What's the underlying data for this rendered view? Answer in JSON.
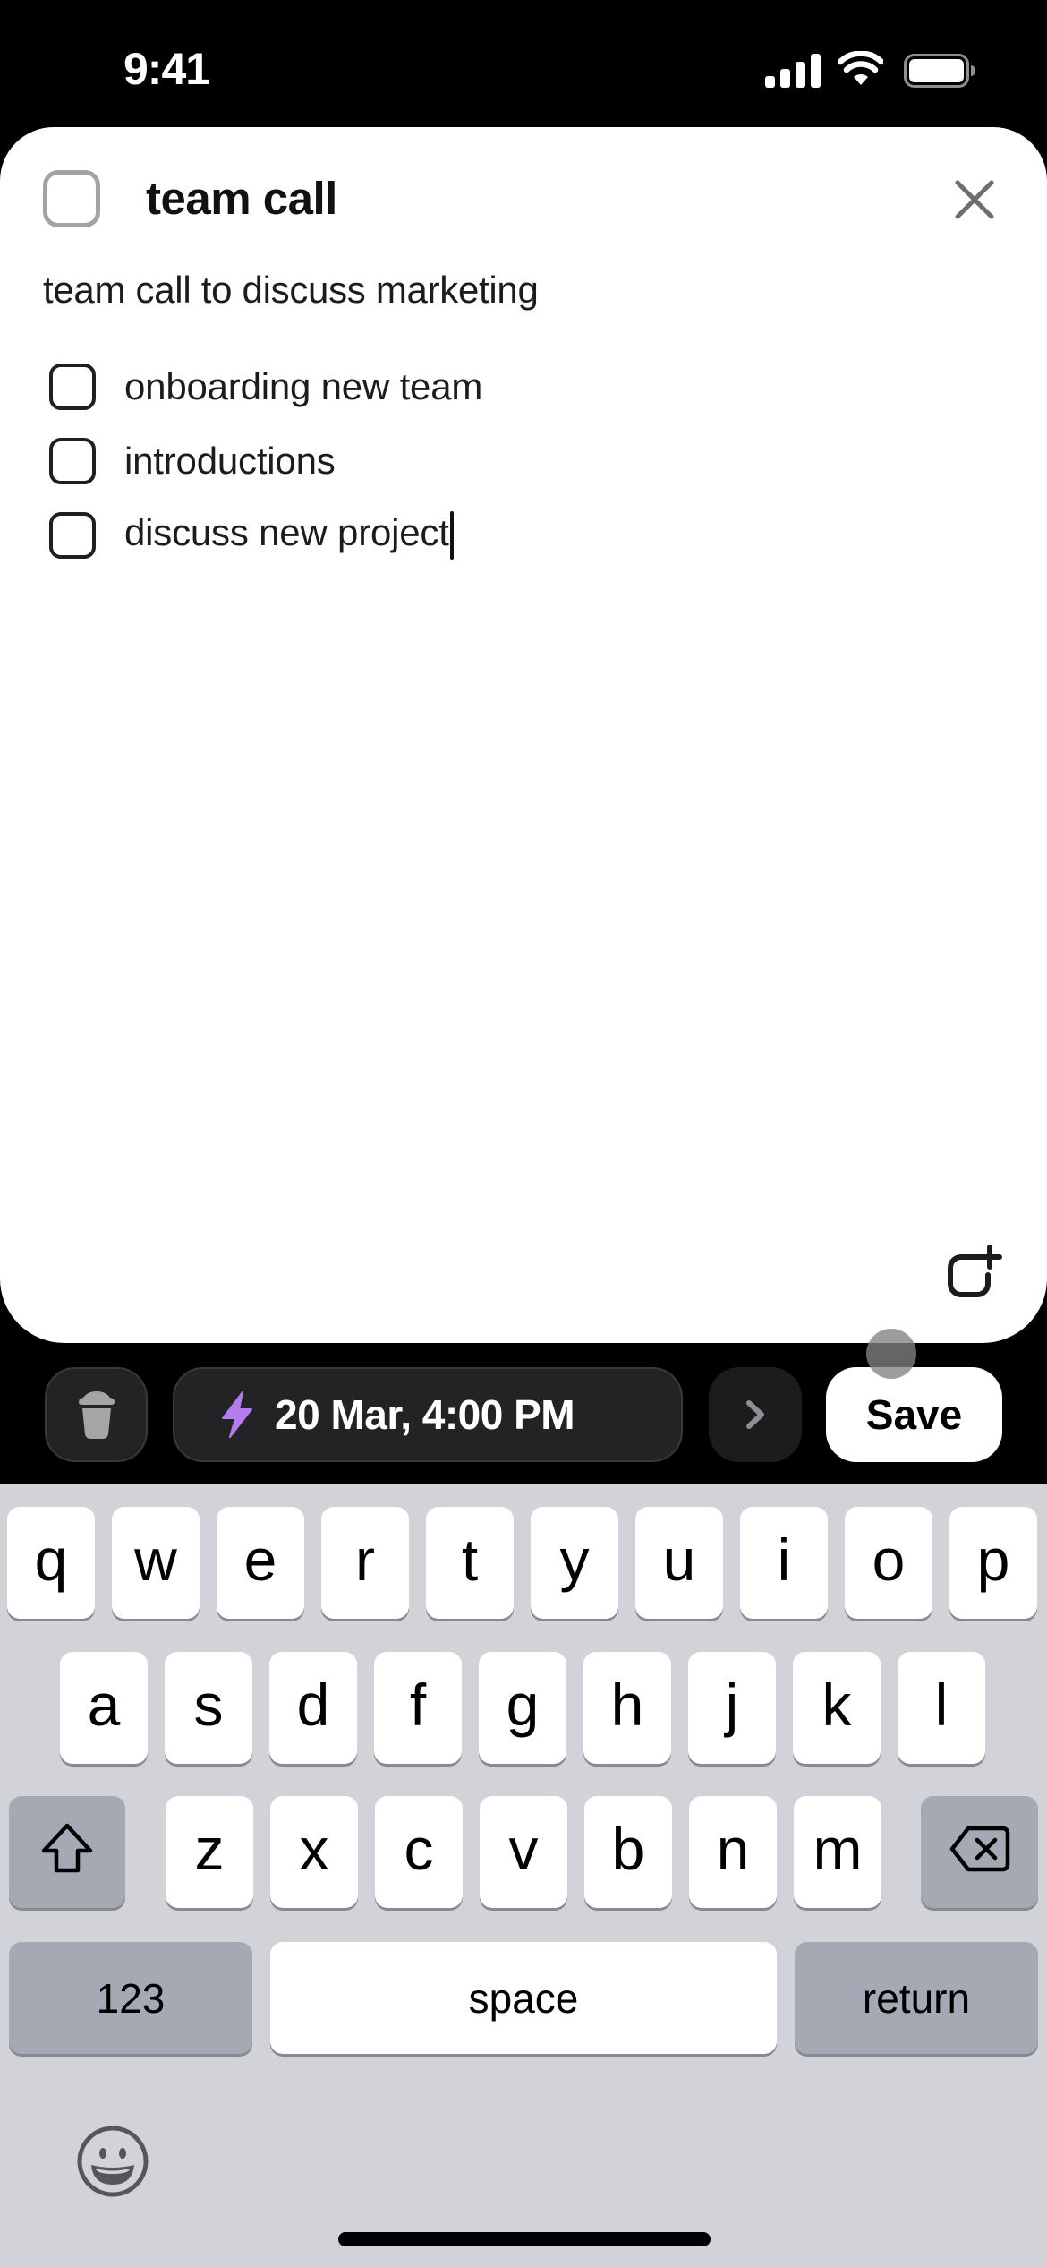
{
  "status_bar": {
    "time": "9:41",
    "icons": [
      "cellular-signal-icon",
      "wifi-icon",
      "battery-icon"
    ]
  },
  "task": {
    "completed": false,
    "title": "team call",
    "description": "team call to discuss marketing",
    "subtasks": [
      {
        "label": "onboarding new team",
        "completed": false
      },
      {
        "label": "introductions",
        "completed": false
      },
      {
        "label": "discuss new project",
        "completed": false,
        "editing": true
      }
    ]
  },
  "toolbar": {
    "delete_icon": "trash-icon",
    "date_icon": "lightning-bolt-icon",
    "date_label": "20 Mar, 4:00 PM",
    "next_icon": "chevron-right-icon",
    "save_label": "Save",
    "accent_color": "#b57cf0"
  },
  "keyboard": {
    "row1": [
      "q",
      "w",
      "e",
      "r",
      "t",
      "y",
      "u",
      "i",
      "o",
      "p"
    ],
    "row2": [
      "a",
      "s",
      "d",
      "f",
      "g",
      "h",
      "j",
      "k",
      "l"
    ],
    "row3": [
      "z",
      "x",
      "c",
      "v",
      "b",
      "n",
      "m"
    ],
    "shift_icon": "shift-icon",
    "backspace_icon": "backspace-icon",
    "numbers_label": "123",
    "space_label": "space",
    "return_label": "return",
    "emoji_icon": "emoji-icon"
  }
}
